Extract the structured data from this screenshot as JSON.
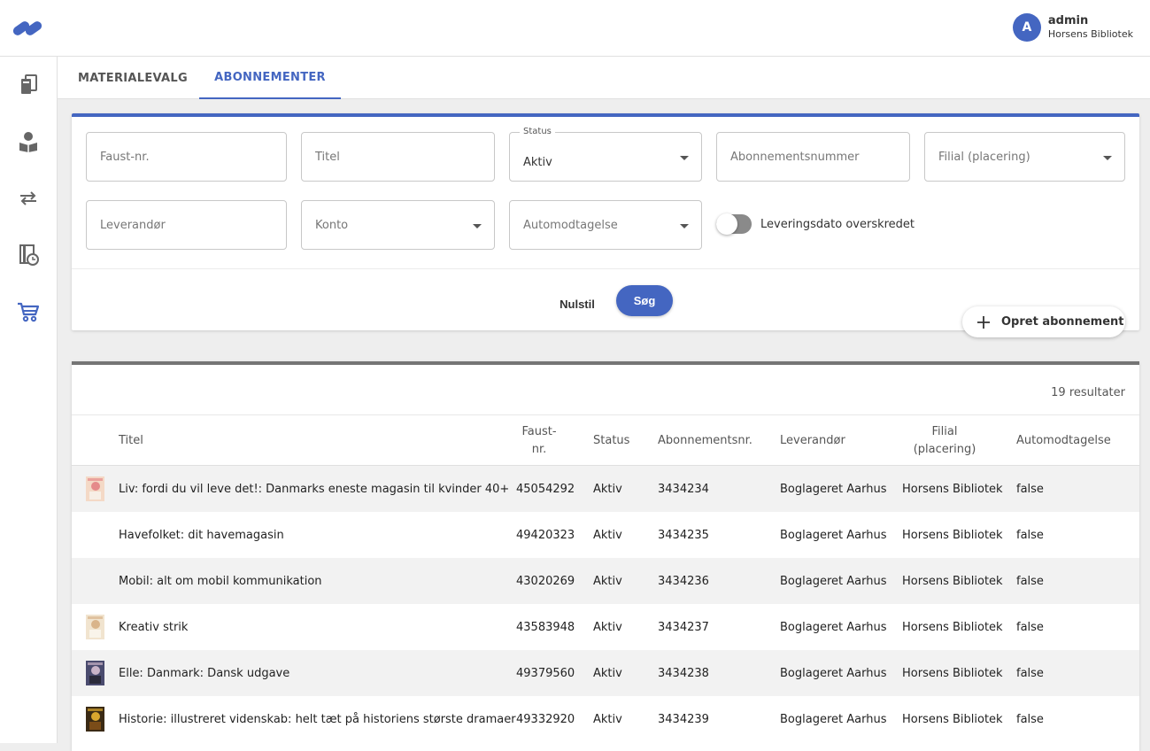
{
  "header": {
    "user": {
      "initial": "A",
      "name": "admin",
      "organization": "Horsens Bibliotek"
    }
  },
  "sidebar": {
    "items": [
      {
        "icon": "books-icon",
        "active": false
      },
      {
        "icon": "reader-icon",
        "active": false
      },
      {
        "icon": "transfer-arrows-icon",
        "active": false
      },
      {
        "icon": "book-clock-icon",
        "active": false
      },
      {
        "icon": "shopping-cart-icon",
        "active": true
      }
    ]
  },
  "tabs": [
    {
      "label": "MATERIALEVALG",
      "active": false
    },
    {
      "label": "ABONNEMENTER",
      "active": true
    }
  ],
  "filters": {
    "faust": {
      "placeholder": "Faust-nr."
    },
    "titel": {
      "placeholder": "Titel"
    },
    "status": {
      "label": "Status",
      "value": "Aktiv"
    },
    "abonnementsnummer": {
      "placeholder": "Abonnementsnummer"
    },
    "filial": {
      "placeholder": "Filial (placering)"
    },
    "leverandor": {
      "placeholder": "Leverandør"
    },
    "konto": {
      "placeholder": "Konto"
    },
    "automodtagelse": {
      "placeholder": "Automodtagelse"
    },
    "toggle": {
      "label": "Leveringsdato overskredet",
      "on": false
    },
    "reset_label": "Nulstil",
    "search_label": "Søg"
  },
  "create_button": {
    "label": "Opret abonnement"
  },
  "results": {
    "count_label": "19 resultater",
    "columns": {
      "titel": "Titel",
      "faust_line1": "Faust-",
      "faust_line2": "nr.",
      "status": "Status",
      "abonnementsnr": "Abonnementsnr.",
      "leverandor": "Leverandør",
      "filial_line1": "Filial",
      "filial_line2": "(placering)",
      "automodtagelse": "Automodtagelse"
    },
    "rows": [
      {
        "thumb": "magazine-liv",
        "titel": "Liv: fordi du vil leve det!: Danmarks eneste magasin til kvinder 40+",
        "faust": "45054292",
        "status": "Aktiv",
        "abonnementsnr": "3434234",
        "leverandor": "Boglageret Aarhus",
        "filial": "Horsens Bibliotek",
        "automodtagelse": "false"
      },
      {
        "thumb": "",
        "titel": "Havefolket: dit havemagasin",
        "faust": "49420323",
        "status": "Aktiv",
        "abonnementsnr": "3434235",
        "leverandor": "Boglageret Aarhus",
        "filial": "Horsens Bibliotek",
        "automodtagelse": "false"
      },
      {
        "thumb": "",
        "titel": "Mobil: alt om mobil kommunikation",
        "faust": "43020269",
        "status": "Aktiv",
        "abonnementsnr": "3434236",
        "leverandor": "Boglageret Aarhus",
        "filial": "Horsens Bibliotek",
        "automodtagelse": "false"
      },
      {
        "thumb": "magazine-kreativ",
        "titel": "Kreativ strik",
        "faust": "43583948",
        "status": "Aktiv",
        "abonnementsnr": "3434237",
        "leverandor": "Boglageret Aarhus",
        "filial": "Horsens Bibliotek",
        "automodtagelse": "false"
      },
      {
        "thumb": "magazine-elle",
        "titel": "Elle: Danmark: Dansk udgave",
        "faust": "49379560",
        "status": "Aktiv",
        "abonnementsnr": "3434238",
        "leverandor": "Boglageret Aarhus",
        "filial": "Horsens Bibliotek",
        "automodtagelse": "false"
      },
      {
        "thumb": "magazine-historie",
        "titel": "Historie: illustreret videnskab: helt tæt på historiens største dramaer",
        "faust": "49332920",
        "status": "Aktiv",
        "abonnementsnr": "3434239",
        "leverandor": "Boglageret Aarhus",
        "filial": "Horsens Bibliotek",
        "automodtagelse": "false"
      }
    ]
  },
  "colors": {
    "accent": "#4466c1",
    "toggle_off": "#8a8a8a",
    "results_border": "#757575"
  }
}
